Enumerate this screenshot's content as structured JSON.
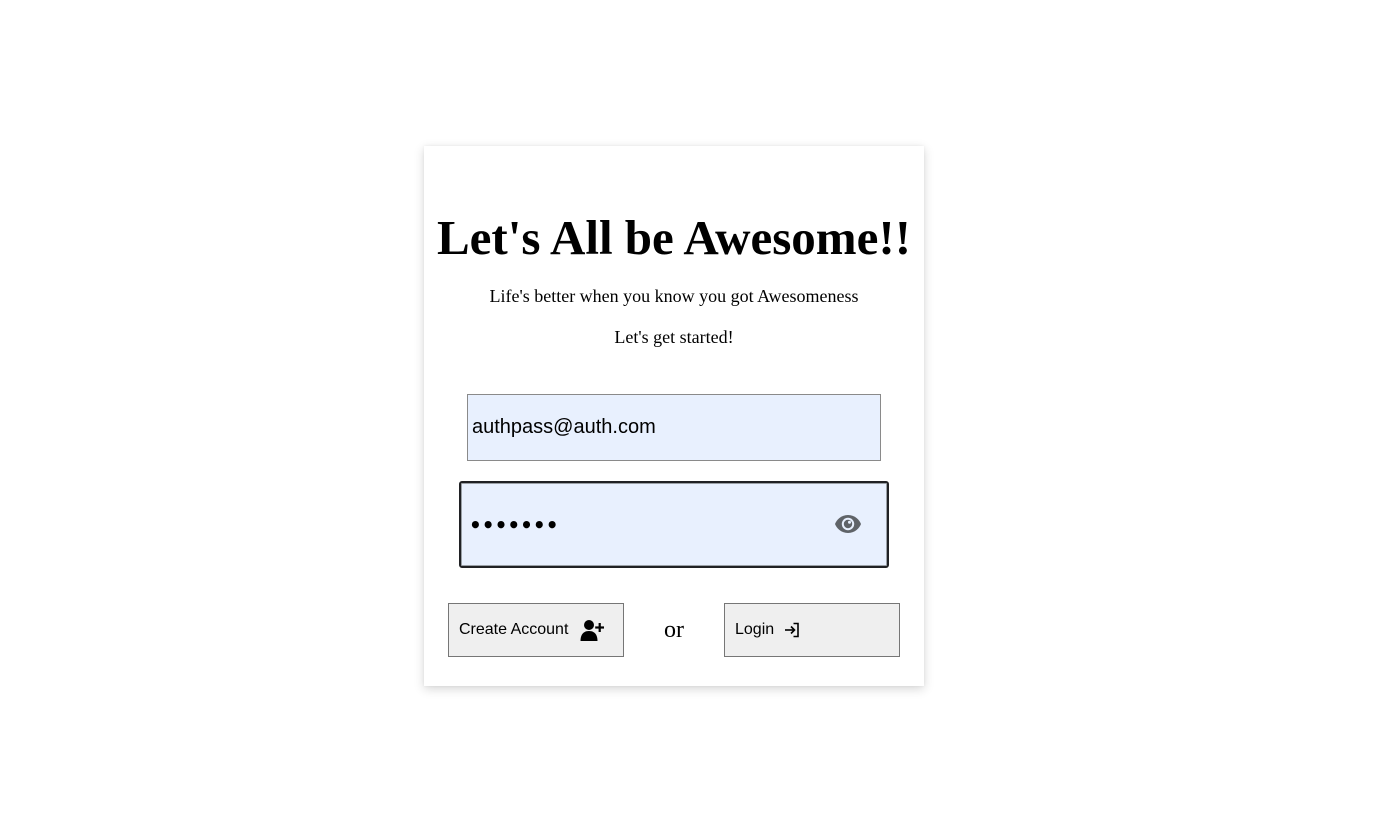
{
  "card": {
    "title": "Let's All be Awesome!!",
    "subtitle": "Life's better when you know you got Awesomeness",
    "tagline": "Let's get started!"
  },
  "form": {
    "email_value": "authpass@auth.com",
    "password_value": "•••••••",
    "toggle_icon": "eye-icon"
  },
  "actions": {
    "create_label": "Create Account",
    "create_icon": "user-plus-icon",
    "separator": "or",
    "login_label": "Login",
    "login_icon": "sign-in-icon"
  },
  "colors": {
    "autofill_background": "#e8f0fe",
    "button_background": "#efefef",
    "eye_icon": "#5f6368"
  }
}
